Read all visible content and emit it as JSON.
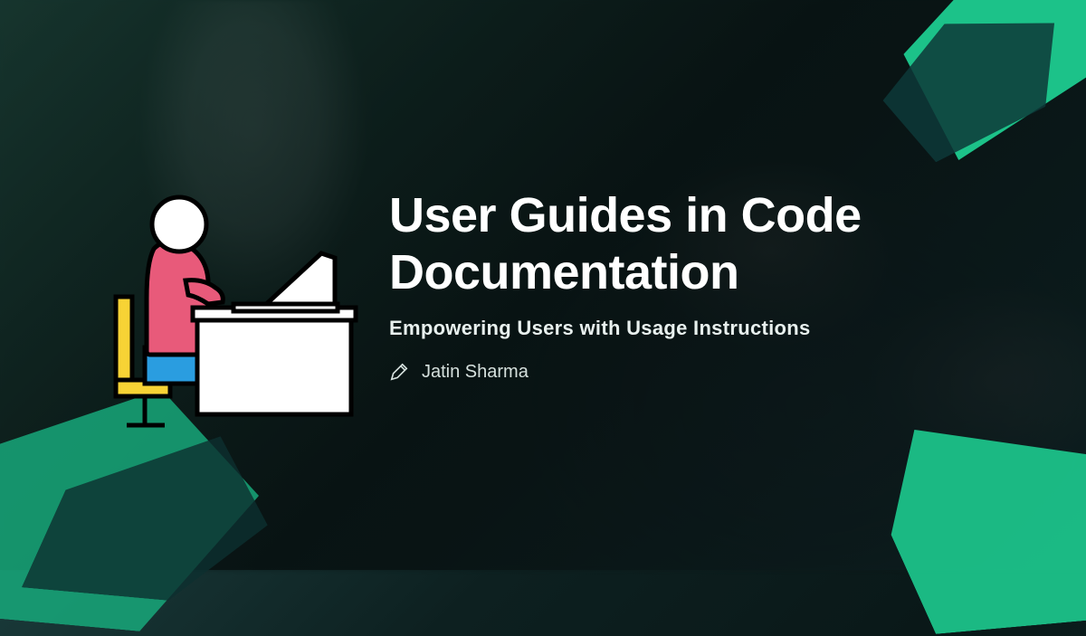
{
  "title": "User Guides in Code Documentation",
  "subtitle": "Empowering Users with Usage Instructions",
  "author": "Jatin Sharma",
  "colors": {
    "accent": "#1dcb8f",
    "chair": "#f7d335",
    "shirt": "#e85a7a",
    "pants": "#2a9de0"
  }
}
